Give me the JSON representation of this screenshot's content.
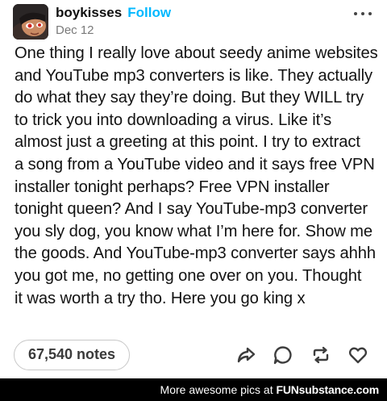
{
  "post": {
    "username": "boykisses",
    "follow_label": "Follow",
    "date": "Dec 12",
    "body": "One thing I really love about seedy anime websites\nand YouTube mp3 converters is like. They actually\ndo what they say they’re doing. But they WILL try\nto trick you into downloading a virus. Like it’s\nalmost just a greeting at this point. I try to extract\na song from a YouTube video and it says free VPN\ninstaller tonight perhaps? Free VPN installer\ntonight queen? And I say YouTube-mp3 converter\nyou sly dog, you know what I’m here for. Show me\nthe goods. And YouTube-mp3 converter says ahhh\nyou got me, no getting one over on you. Thought\nit was worth a try tho. Here you go king x",
    "notes": "67,540 notes"
  },
  "actions": {
    "icons": [
      "share-icon",
      "reply-icon",
      "reblog-icon",
      "heart-icon"
    ]
  },
  "banner": {
    "text": "More awesome pics at",
    "brand_part1": "FUN",
    "brand_part2": "substance.com"
  },
  "colors": {
    "follow": "#00b8ff",
    "text": "#121212",
    "muted": "#7a7a7a",
    "banner_bg": "#000000"
  }
}
